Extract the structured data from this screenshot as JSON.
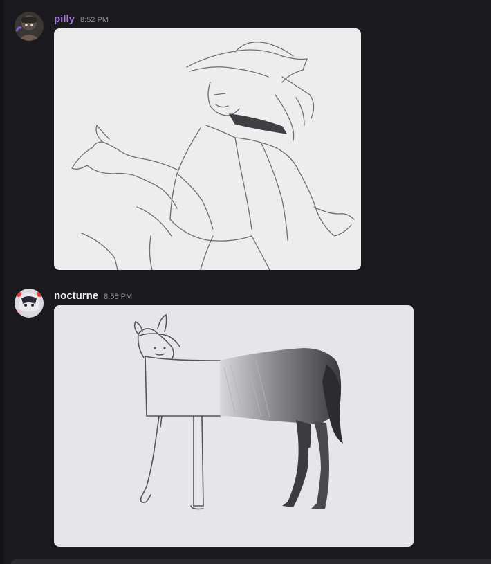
{
  "messages": [
    {
      "username": "pilly",
      "username_color": "#a678d6",
      "timestamp": "8:52 PM",
      "attachment_kind": "image",
      "avatar_kind": "user-avatar"
    },
    {
      "username": "nocturne",
      "username_color": "#f2f3f5",
      "timestamp": "8:55 PM",
      "attachment_kind": "image",
      "avatar_kind": "user-avatar"
    }
  ],
  "theme": {
    "background": "#1a1a1e",
    "timestamp_color": "#8f9098"
  }
}
